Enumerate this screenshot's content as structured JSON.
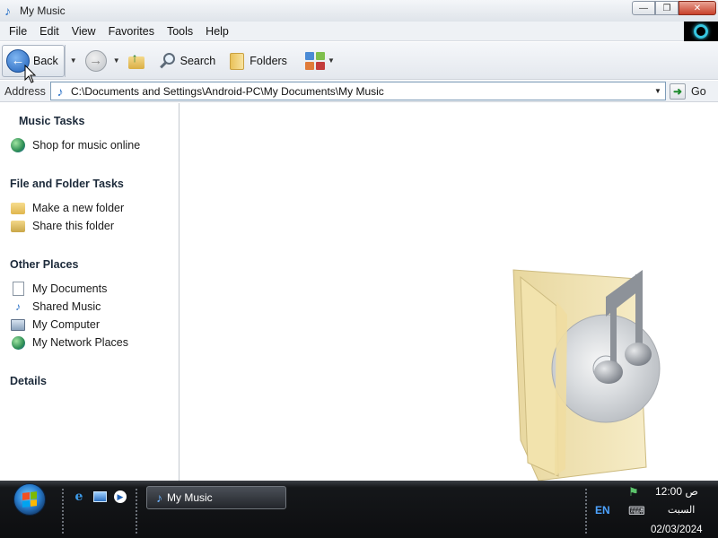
{
  "window": {
    "title": "My Music",
    "buttons": {
      "minimize": "—",
      "restore": "❐",
      "close": "✕"
    }
  },
  "menu": [
    "File",
    "Edit",
    "View",
    "Favorites",
    "Tools",
    "Help"
  ],
  "toolbar": {
    "back_label": "Back",
    "search_label": "Search",
    "folders_label": "Folders"
  },
  "address": {
    "label": "Address",
    "path": "C:\\Documents and Settings\\Android-PC\\My Documents\\My Music",
    "go_label": "Go"
  },
  "left_pane": {
    "music_tasks": {
      "title": "Music Tasks",
      "items": [
        "Shop for music online"
      ]
    },
    "file_folder_tasks": {
      "title": "File and Folder Tasks",
      "items": [
        "Make a new folder",
        "Share this folder"
      ]
    },
    "other_places": {
      "title": "Other Places",
      "items": [
        "My Documents",
        "Shared Music",
        "My Computer",
        "My Network Places"
      ]
    },
    "details": {
      "title": "Details"
    }
  },
  "taskbar": {
    "window_button": "My Music",
    "clock": {
      "time": "12:00 ص",
      "day": "السبت",
      "date": "02/03/2024"
    }
  },
  "colors": {
    "accent": "#2a72c8",
    "taskbar": "#0d0e10",
    "folder": "#f1d98e"
  }
}
